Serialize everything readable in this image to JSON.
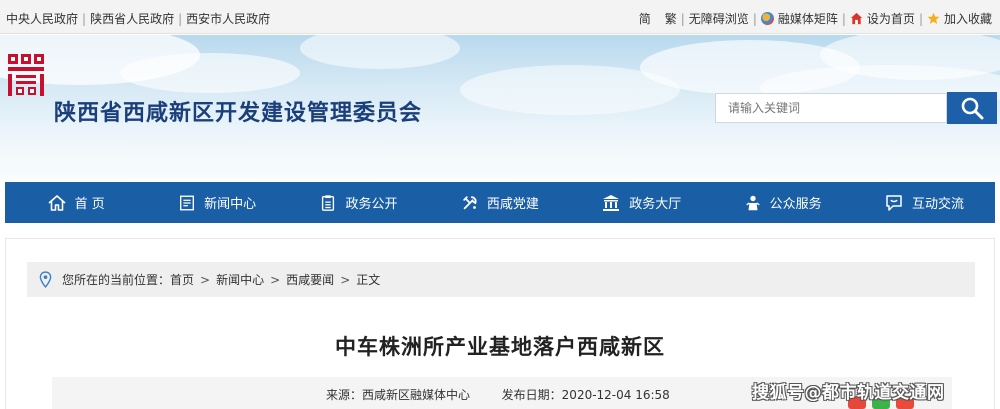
{
  "topbar": {
    "links": [
      "中央人民政府",
      "陕西省人民政府",
      "西安市人民政府"
    ],
    "separator": "|",
    "simplified": "简",
    "traditional": "繁",
    "accessibility": "无障碍浏览",
    "media_matrix": "融媒体矩阵",
    "set_home": "设为首页",
    "add_favorite": "加入收藏"
  },
  "header": {
    "site_title": "陕西省西咸新区开发建设管理委员会",
    "search_placeholder": "请输入关键词"
  },
  "nav": {
    "items": [
      {
        "label": "首 页",
        "icon": "home-icon"
      },
      {
        "label": "新闻中心",
        "icon": "document-icon"
      },
      {
        "label": "政务公开",
        "icon": "clipboard-icon"
      },
      {
        "label": "西咸党建",
        "icon": "party-emblem-icon"
      },
      {
        "label": "政务大厅",
        "icon": "government-building-icon"
      },
      {
        "label": "公众服务",
        "icon": "people-icon"
      },
      {
        "label": "互动交流",
        "icon": "chat-bubble-icon"
      }
    ]
  },
  "breadcrumb": {
    "label": "您所在的当前位置：",
    "items": [
      "首页",
      "新闻中心",
      "西咸要闻",
      "正文"
    ],
    "separator": ">"
  },
  "article": {
    "title": "中车株洲所产业基地落户西咸新区",
    "source": "来源：西咸新区融媒体中心",
    "date": "发布日期：2020-12-04 16:58"
  },
  "watermark": "搜狐号@都市轨道交通网",
  "colors": {
    "nav_bg": "#1a5ea6",
    "title_blue": "#1a3f7a",
    "logo_red": "#c8102e",
    "search_btn": "#1d5fa8"
  }
}
